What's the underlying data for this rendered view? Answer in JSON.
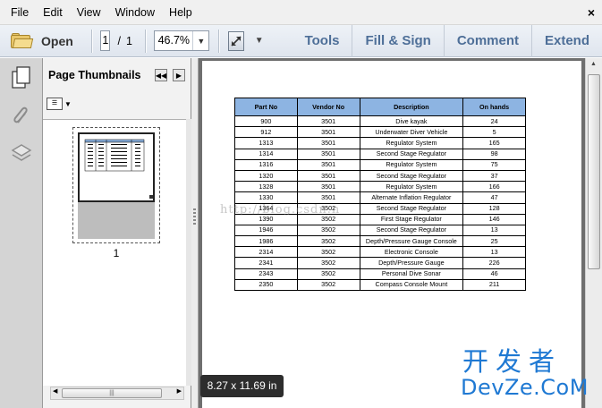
{
  "menu": {
    "items": [
      "File",
      "Edit",
      "View",
      "Window",
      "Help"
    ],
    "close_glyph": "×"
  },
  "toolbar": {
    "open_label": "Open",
    "page_current": "1",
    "page_separator": "/",
    "page_total": "1",
    "zoom": "46.7%",
    "tools": [
      "Tools",
      "Fill & Sign",
      "Comment",
      "Extend"
    ]
  },
  "panel": {
    "title": "Page Thumbnails",
    "thumb_page_number": "1"
  },
  "document": {
    "table": {
      "headers": [
        "Part No",
        "Vendor No",
        "Description",
        "On hands"
      ],
      "rows": [
        [
          "900",
          "3501",
          "Dive kayak",
          "24"
        ],
        [
          "912",
          "3501",
          "Underwater Diver Vehicle",
          "5"
        ],
        [
          "1313",
          "3501",
          "Regulator System",
          "165"
        ],
        [
          "1314",
          "3501",
          "Second Stage Regulator",
          "98"
        ],
        [
          "1316",
          "3501",
          "Regulator System",
          "75"
        ],
        [
          "1320",
          "3501",
          "Second Stage Regulator",
          "37"
        ],
        [
          "1328",
          "3501",
          "Regulator System",
          "166"
        ],
        [
          "1330",
          "3501",
          "Alternate Inflation Regulator",
          "47"
        ],
        [
          "1364",
          "3502",
          "Second Stage Regulator",
          "128"
        ],
        [
          "1390",
          "3502",
          "First Stage Regulator",
          "146"
        ],
        [
          "1946",
          "3502",
          "Second Stage Regulator",
          "13"
        ],
        [
          "1986",
          "3502",
          "Depth/Pressure Gauge Console",
          "25"
        ],
        [
          "2314",
          "3502",
          "Electronic Console",
          "13"
        ],
        [
          "2341",
          "3502",
          "Depth/Pressure Gauge",
          "226"
        ],
        [
          "2343",
          "3502",
          "Personal Dive Sonar",
          "46"
        ],
        [
          "2350",
          "3502",
          "Compass Console Mount",
          "211"
        ]
      ]
    },
    "watermark": "http://blog.csdn.n"
  },
  "status": {
    "page_size": "8.27 x 11.69 in"
  },
  "logo": {
    "cn": "开发者",
    "en": "DevZe.CoM"
  },
  "colors": {
    "header_fill": "#8db4e2",
    "tool_link": "#4e6f98",
    "logo": "#1f79d3"
  }
}
